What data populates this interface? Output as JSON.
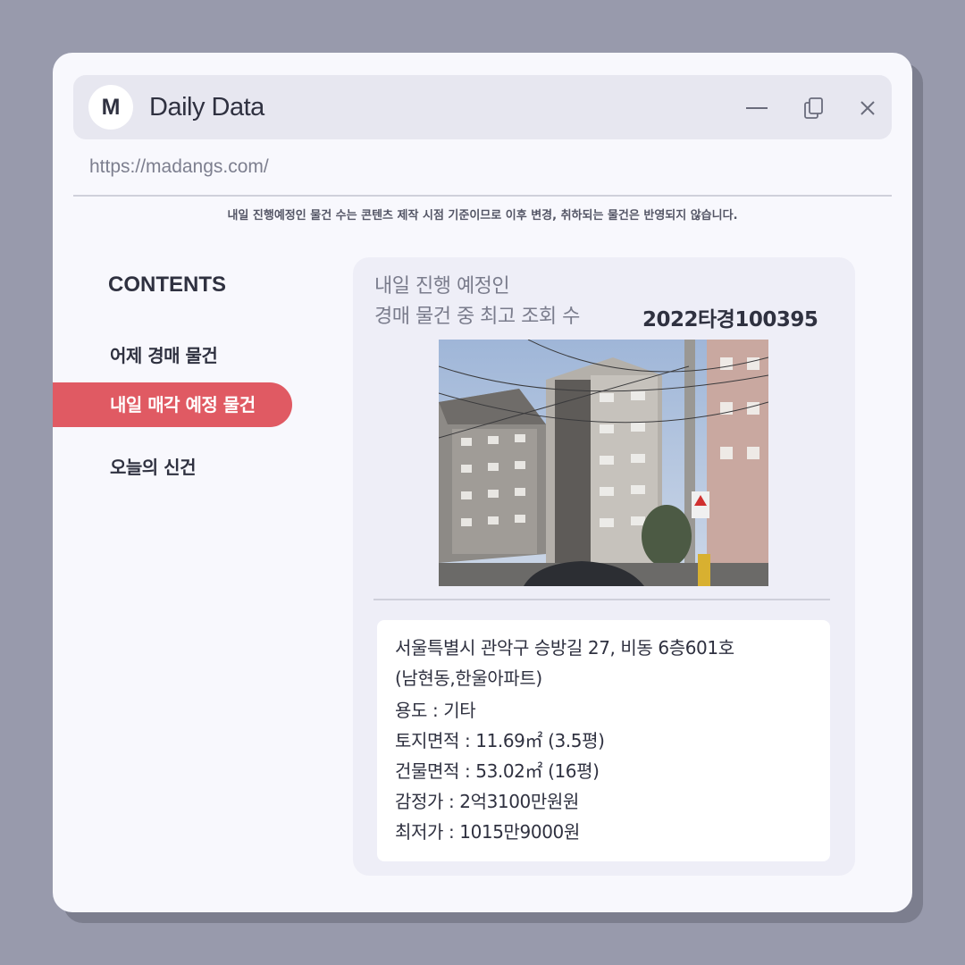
{
  "window": {
    "logo_letter": "M",
    "title": "Daily Data",
    "url": "https://madangs.com/"
  },
  "notice": "내일 진행예정인 물건 수는 콘텐츠 제작 시점 기준이므로 이후 변경, 취하되는 물건은 반영되지 않습니다.",
  "sidebar": {
    "heading": "CONTENTS",
    "items": [
      {
        "label": "어제 경매 물건",
        "active": false
      },
      {
        "label": "내일 매각 예정 물건",
        "active": true
      },
      {
        "label": "오늘의 신건",
        "active": false
      }
    ]
  },
  "card": {
    "heading_line1": "내일 진행 예정인",
    "heading_line2": "경매 물건 중 최고 조회 수",
    "case_number": "2022타경100395",
    "address_line1": "서울특별시 관악구 승방길 27, 비동 6층601호",
    "address_line2": "(남현동,한울아파트)",
    "usage": "용도 : 기타",
    "land_area": "토지면적 : 11.69㎡ (3.5평)",
    "building_area": "건물면적 : 53.02㎡ (16평)",
    "appraisal": "감정가 : 2억3100만원원",
    "minimum": "최저가 : 1015만9000원"
  },
  "colors": {
    "accent": "#e05a63",
    "background": "#989aac",
    "window": "#f8f8fd",
    "card": "#eeeef7"
  },
  "icons": [
    "minimize-icon",
    "restore-icon",
    "close-icon"
  ]
}
